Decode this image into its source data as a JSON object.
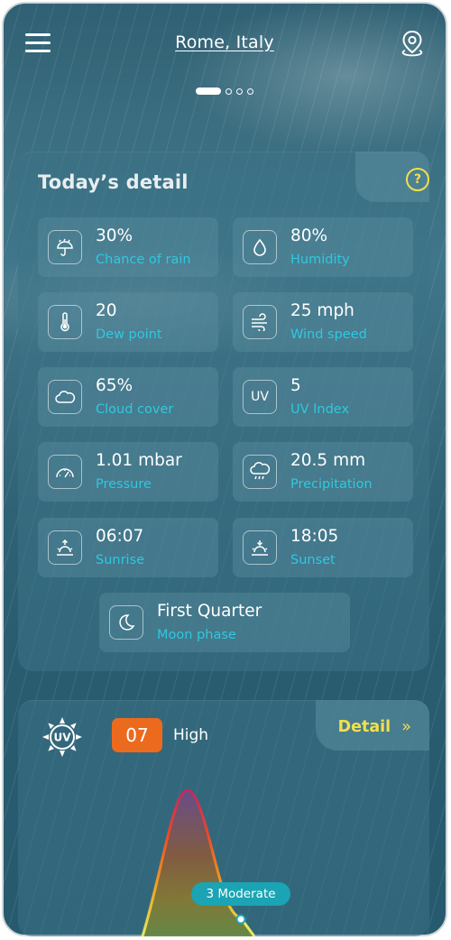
{
  "header": {
    "city": "Rome, Italy",
    "menu_icon": "hamburger-menu-icon",
    "location_icon": "location-pin-icon",
    "page_count": 4,
    "active_page": 1
  },
  "details": {
    "title": "Today’s detail",
    "help_label": "?",
    "items": [
      {
        "icon": "umbrella-rain-icon",
        "value": "30%",
        "label": "Chance of rain"
      },
      {
        "icon": "droplet-icon",
        "value": "80%",
        "label": "Humidity"
      },
      {
        "icon": "thermometer-icon",
        "value": "20",
        "label": "Dew point"
      },
      {
        "icon": "wind-icon",
        "value": "25 mph",
        "label": "Wind speed"
      },
      {
        "icon": "cloud-icon",
        "value": "65%",
        "label": "Cloud cover"
      },
      {
        "icon": "uv-text-icon",
        "icon_text": "UV",
        "value": "5",
        "label": "UV Index"
      },
      {
        "icon": "gauge-icon",
        "value": "1.01 mbar",
        "label": "Pressure"
      },
      {
        "icon": "rain-cloud-icon",
        "value": "20.5 mm",
        "label": "Precipitation"
      },
      {
        "icon": "sunrise-icon",
        "value": "06:07",
        "label": "Sunrise"
      },
      {
        "icon": "sunset-icon",
        "value": "18:05",
        "label": "Sunset"
      },
      {
        "icon": "moon-icon",
        "value": "First Quarter",
        "label": "Moon phase"
      }
    ]
  },
  "uv": {
    "badge_icon": "uv-sun-icon",
    "badge_text": "UV",
    "value": "07",
    "level": "High",
    "detail_label": "Detail",
    "detail_icon": "double-chevron-right-icon",
    "marker_label": "3 Moderate",
    "colors": {
      "accent": "#ec6a1e",
      "link": "#f2e04a",
      "pill": "#1aa4b4"
    }
  }
}
